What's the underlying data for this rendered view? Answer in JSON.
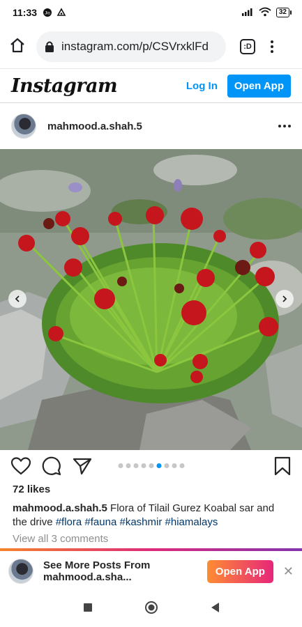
{
  "status_bar": {
    "time": "11:33",
    "battery": "32"
  },
  "browser": {
    "url": "instagram.com/p/CSVrxklFd",
    "tab_switcher_label": ":D"
  },
  "ig_header": {
    "logo": "Instagram",
    "login": "Log In",
    "open_app": "Open App"
  },
  "post": {
    "username": "mahmood.a.shah.5",
    "likes": "72 likes",
    "caption": {
      "user": "mahmood.a.shah.5",
      "text": "Flora of Tilail Gurez Koabal sar and the drive",
      "tags": [
        "#flora",
        "#fauna",
        "#kashmir",
        "#hiamalays"
      ]
    },
    "view_comments": "View all 3 comments",
    "carousel": {
      "total": 9,
      "active": 6
    }
  },
  "banner": {
    "line1": "See More Posts From",
    "line2": "mahmood.a.sha...",
    "button": "Open App",
    "close": "✕"
  },
  "colors": {
    "accent": "#0095f6",
    "banner_gradient_start": "#fd8d32",
    "banner_gradient_end": "#e7267a"
  }
}
